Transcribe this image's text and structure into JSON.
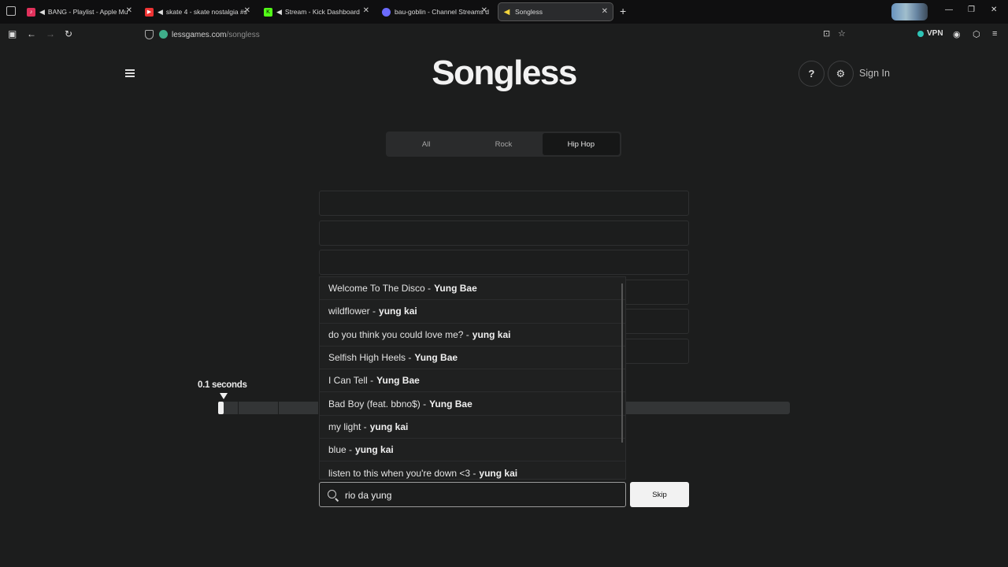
{
  "browser": {
    "tabs": [
      {
        "title": "BANG - Playlist - Apple Mu",
        "favicon_color": "#e0315b",
        "muted": true
      },
      {
        "title": "skate 4 - skate nostalgia #s",
        "favicon_color": "#e33",
        "muted": true
      },
      {
        "title": "Stream - Kick Dashboard",
        "favicon_color": "#53fc18",
        "muted": true
      },
      {
        "title": "bau-goblin - Channel Streams d",
        "favicon_color": "#6b6bff",
        "muted": false
      },
      {
        "title": "Songless",
        "favicon_color": "#f2d33b",
        "muted": false
      }
    ],
    "url_domain": "lessgames.com",
    "url_path": "/songless",
    "vpn_label": "VPN"
  },
  "header": {
    "logo": "Songless",
    "help_label": "?",
    "sign_in": "Sign In"
  },
  "genres": [
    "All",
    "Rock",
    "Hip Hop"
  ],
  "active_genre": "Hip Hop",
  "timeline": {
    "seconds_label": "0.1 seconds",
    "progress_fraction": 0.01
  },
  "suggestions": [
    {
      "song": "Welcome To The Disco -",
      "artist": "Yung Bae"
    },
    {
      "song": "wildflower -",
      "artist": "yung kai"
    },
    {
      "song": "do you think you could love me? -",
      "artist": "yung kai"
    },
    {
      "song": "Selfish High Heels -",
      "artist": "Yung Bae"
    },
    {
      "song": "I Can Tell -",
      "artist": "Yung Bae"
    },
    {
      "song": "Bad Boy (feat. bbno$) -",
      "artist": "Yung Bae"
    },
    {
      "song": "my light -",
      "artist": "yung kai"
    },
    {
      "song": "blue -",
      "artist": "yung kai"
    },
    {
      "song": "listen to this when you're down <3 -",
      "artist": "yung kai"
    }
  ],
  "search": {
    "value": "rio da yung"
  },
  "skip_label": "Skip"
}
